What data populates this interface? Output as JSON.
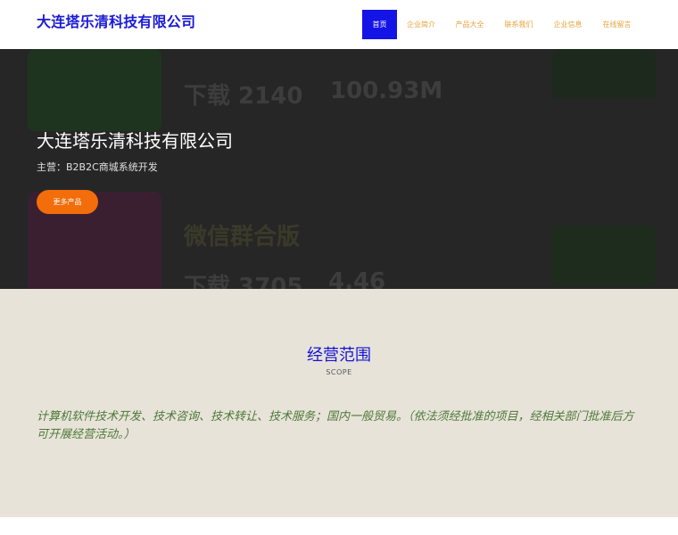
{
  "header": {
    "logo": "大连塔乐清科技有限公司",
    "nav": [
      {
        "label": "首页"
      },
      {
        "label": "企业简介"
      },
      {
        "label": "产品大全"
      },
      {
        "label": "联系我们"
      },
      {
        "label": "企业信息"
      },
      {
        "label": "在线留言"
      }
    ]
  },
  "hero": {
    "title": "大连塔乐清科技有限公司",
    "subtitle": "主营：B2B2C商城系统开发",
    "button": "更多产品",
    "bg_texts": [
      "下载 2140",
      "100.93M",
      "微信群合版",
      "下载 3705",
      "4.46"
    ]
  },
  "scope": {
    "title": "经营范围",
    "subtitle": "SCOPE",
    "text": "计算机软件技术开发、技术咨询、技术转让、技术服务；国内一般贸易。（依法须经批准的项目，经相关部门批准后方可开展经营活动。）"
  },
  "colors": {
    "brand": "#1414e6",
    "accent": "#f36d0a",
    "scope_text": "#4c7a38"
  }
}
